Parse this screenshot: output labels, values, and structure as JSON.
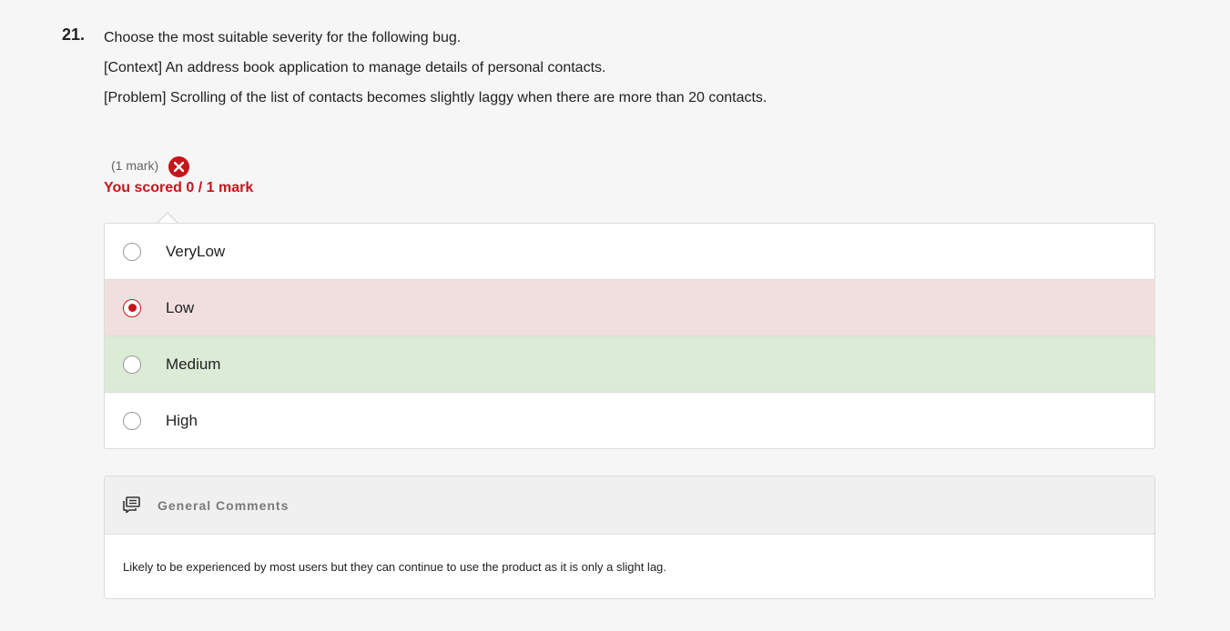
{
  "question": {
    "number": "21.",
    "lines": [
      "Choose the most suitable severity for the following bug.",
      "[Context] An address book application to manage details of personal contacts.",
      "[Problem] Scrolling of the list of contacts becomes slightly laggy when there are more than 20 contacts."
    ],
    "mark_label": "(1 mark)",
    "result_icon": "x-circle-icon",
    "score_text": "You scored 0 / 1 mark"
  },
  "options": [
    {
      "label": "VeryLow",
      "selected": false,
      "state": "neutral"
    },
    {
      "label": "Low",
      "selected": true,
      "state": "incorrect"
    },
    {
      "label": "Medium",
      "selected": false,
      "state": "correct"
    },
    {
      "label": "High",
      "selected": false,
      "state": "neutral"
    }
  ],
  "comments": {
    "icon": "comments-icon",
    "title": "General Comments",
    "body": "Likely to be experienced by most users but they can continue to use the product as it is only a slight lag."
  },
  "colors": {
    "accent": "#c4161c",
    "incorrect_bg": "#f1dfdf",
    "correct_bg": "#dbebd6",
    "page_bg": "#f6f6f6"
  }
}
